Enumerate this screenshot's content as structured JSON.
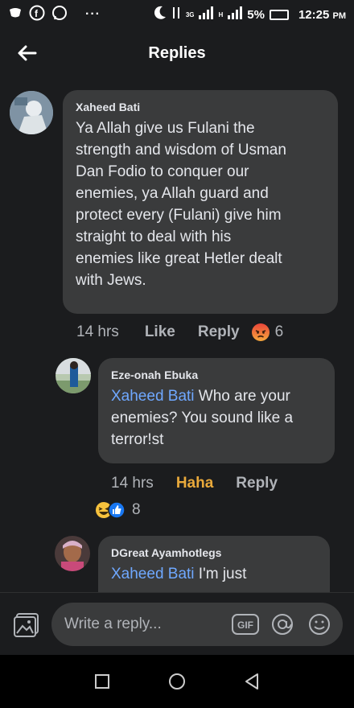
{
  "status_bar": {
    "dots": "···",
    "network": "3G",
    "network2": "H",
    "battery_pct": "5%",
    "time": "12:25",
    "ampm": "PM"
  },
  "header": {
    "title": "Replies"
  },
  "comments": [
    {
      "author": "Xaheed Bati",
      "text_lines": [
        "Ya Allah give us Fulani the",
        "strength and wisdom of Usman",
        "Dan Fodio to conquer our",
        "enemies, ya Allah guard and",
        "protect every (Fulani) give him",
        "straight to deal with his",
        "enemies like great Hetler dealt",
        "with Jews."
      ],
      "time": "14 hrs",
      "like_label": "Like",
      "reply_label": "Reply",
      "reaction_count": "6"
    },
    {
      "author": "Eze-onah Ebuka",
      "mention": "Xaheed Bati",
      "text_first_rest": " Who are your",
      "text_lines": [
        "enemies? You sound like a",
        "terror!st"
      ],
      "time": "14 hrs",
      "like_label": "Haha",
      "reply_label": "Reply",
      "reaction_count": "8"
    },
    {
      "author": "DGreat Ayamhotlegs",
      "mention": "Xaheed Bati",
      "text_first_rest": " I'm just"
    }
  ],
  "composer": {
    "placeholder": "Write a reply...",
    "gif_label": "GIF"
  },
  "colors": {
    "background": "#1b1c1e",
    "bubble": "#3a3b3c",
    "mention": "#6fa8ff",
    "haha": "#e9a93b"
  }
}
